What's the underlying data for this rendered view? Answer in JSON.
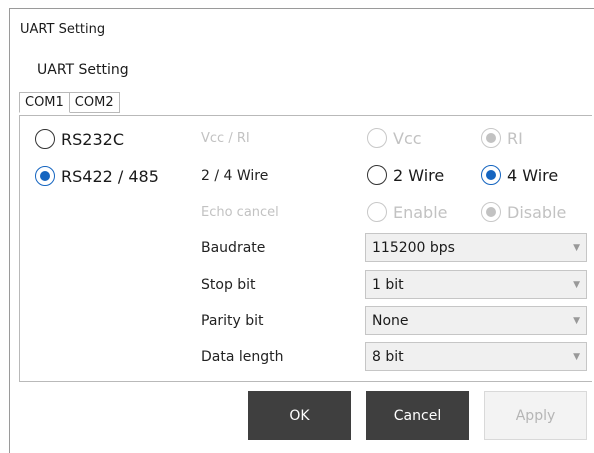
{
  "window": {
    "title": "UART Setting"
  },
  "group": {
    "title": "UART Setting"
  },
  "tabs": [
    {
      "label": "COM1"
    },
    {
      "label": "COM2"
    }
  ],
  "mode": {
    "rs232c": {
      "label": "RS232C",
      "checked": false
    },
    "rs422": {
      "label": "RS422 / 485",
      "checked": true
    }
  },
  "vcc_ri": {
    "label": "Vcc / RI",
    "options": [
      "Vcc",
      "RI"
    ],
    "selected": "RI"
  },
  "wire": {
    "label": "2 / 4 Wire",
    "options": [
      "2 Wire",
      "4 Wire"
    ],
    "selected": "4 Wire"
  },
  "echo": {
    "label": "Echo cancel",
    "options": [
      "Enable",
      "Disable"
    ],
    "selected": "Disable"
  },
  "baudrate": {
    "label": "Baudrate",
    "value": "115200 bps"
  },
  "stopbit": {
    "label": "Stop bit",
    "value": "1 bit"
  },
  "parity": {
    "label": "Parity bit",
    "value": "None"
  },
  "datalength": {
    "label": "Data length",
    "value": "8 bit"
  },
  "buttons": {
    "ok": "OK",
    "cancel": "Cancel",
    "apply": "Apply"
  },
  "colors": {
    "accent": "#1565c0",
    "button_dark": "#3f3f3f"
  }
}
